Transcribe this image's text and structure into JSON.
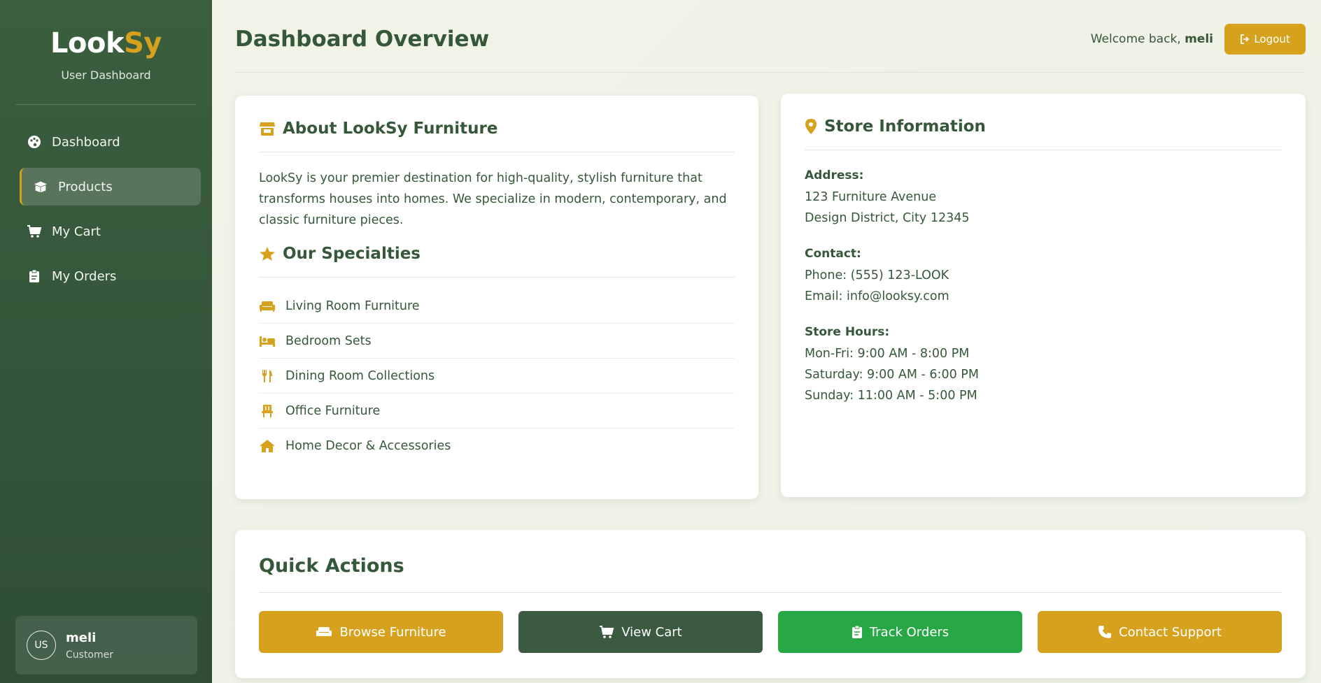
{
  "brand": {
    "name_part1": "Look",
    "name_part2": "Sy",
    "subtitle": "User Dashboard"
  },
  "nav": {
    "items": [
      {
        "label": "Dashboard",
        "icon": "palette-icon",
        "active": false
      },
      {
        "label": "Products",
        "icon": "box-open-icon",
        "active": true
      },
      {
        "label": "My Cart",
        "icon": "cart-icon",
        "active": false
      },
      {
        "label": "My Orders",
        "icon": "clipboard-icon",
        "active": false
      }
    ]
  },
  "user": {
    "initials": "US",
    "name": "meli",
    "role": "Customer"
  },
  "header": {
    "title": "Dashboard Overview",
    "welcome_prefix": "Welcome back, ",
    "welcome_name": "meli",
    "logout_label": "Logout"
  },
  "about": {
    "title": "About LookSy Furniture",
    "text": "LookSy is your premier destination for high-quality, stylish furniture that transforms houses into homes. We specialize in modern, contemporary, and classic furniture pieces.",
    "specialties_title": "Our Specialties",
    "specialties": [
      {
        "label": "Living Room Furniture",
        "icon": "couch-icon"
      },
      {
        "label": "Bedroom Sets",
        "icon": "bed-icon"
      },
      {
        "label": "Dining Room Collections",
        "icon": "utensils-icon"
      },
      {
        "label": "Office Furniture",
        "icon": "chair-icon"
      },
      {
        "label": "Home Decor & Accessories",
        "icon": "home-icon"
      }
    ]
  },
  "store": {
    "title": "Store Information",
    "address_label": "Address:",
    "address_lines": [
      "123 Furniture Avenue",
      "Design District, City 12345"
    ],
    "contact_label": "Contact:",
    "contact_lines": [
      "Phone: (555) 123-LOOK",
      "Email: info@looksy.com"
    ],
    "hours_label": "Store Hours:",
    "hours_lines": [
      "Mon-Fri: 9:00 AM - 8:00 PM",
      "Saturday: 9:00 AM - 6:00 PM",
      "Sunday: 11:00 AM - 5:00 PM"
    ]
  },
  "quick_actions": {
    "title": "Quick Actions",
    "buttons": [
      {
        "label": "Browse Furniture",
        "icon": "couch-icon"
      },
      {
        "label": "View Cart",
        "icon": "cart-icon"
      },
      {
        "label": "Track Orders",
        "icon": "clipboard-icon"
      },
      {
        "label": "Contact Support",
        "icon": "phone-icon"
      }
    ]
  },
  "colors": {
    "accent": "#d6a21e",
    "sidebar": "#3b5e3f",
    "text": "#355838",
    "green": "#28a745",
    "dark_button": "#3b5a40"
  }
}
